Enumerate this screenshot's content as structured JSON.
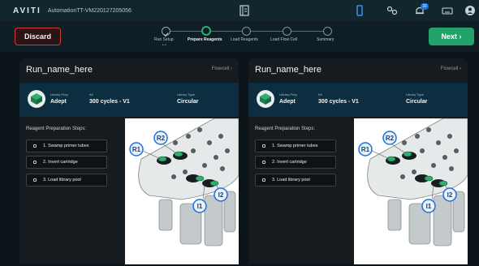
{
  "topbar": {
    "brand": "AVITI",
    "instrument": "AutomationTT-VM220127205056",
    "notification_count": "32",
    "icons": [
      "document-icon",
      "tablet-icon",
      "link-icon",
      "bell-icon",
      "keyboard-icon",
      "user-icon"
    ]
  },
  "actions": {
    "discard": "Discard",
    "next": "Next ›"
  },
  "stepper": {
    "steps": [
      {
        "label": "Run Setup",
        "state": "done",
        "sub": "• •"
      },
      {
        "label": "Prepare Reagents",
        "state": "active"
      },
      {
        "label": "Load Reagents",
        "state": "pending"
      },
      {
        "label": "Load Flow Cell",
        "state": "pending"
      },
      {
        "label": "Summary",
        "state": "pending"
      }
    ]
  },
  "panels": [
    {
      "run_name": "Run_name_here",
      "flowcell": "Flowcell",
      "library_prep_label": "Library Prep",
      "library_prep": "Adept",
      "kit_label": "Kit",
      "kit": "300 cycles - V1",
      "library_type_label": "Library Type",
      "library_type": "Circular",
      "steps_title": "Reagent Preparation Steps:",
      "steps": [
        "1. Swamp primer tubes",
        "2. Invert cartridge",
        "3. Load library pool"
      ],
      "markers": [
        "R1",
        "R2",
        "I1",
        "I2"
      ]
    },
    {
      "run_name": "Run_name_here",
      "flowcell": "Flowcell",
      "library_prep_label": "Library Prep",
      "library_prep": "Adept",
      "kit_label": "Kit",
      "kit": "300 cycles - V1",
      "library_type_label": "Library Type",
      "library_type": "Circular",
      "steps_title": "Reagent Preparation Steps:",
      "steps": [
        "1. Swamp primer tubes",
        "2. Invert cartridge",
        "3. Load library pool"
      ],
      "markers": [
        "R1",
        "R2",
        "I1",
        "I2"
      ]
    }
  ],
  "colors": {
    "accent_green": "#27b074",
    "discard_red": "#d13b37",
    "marker_blue": "#1e6fd9"
  }
}
